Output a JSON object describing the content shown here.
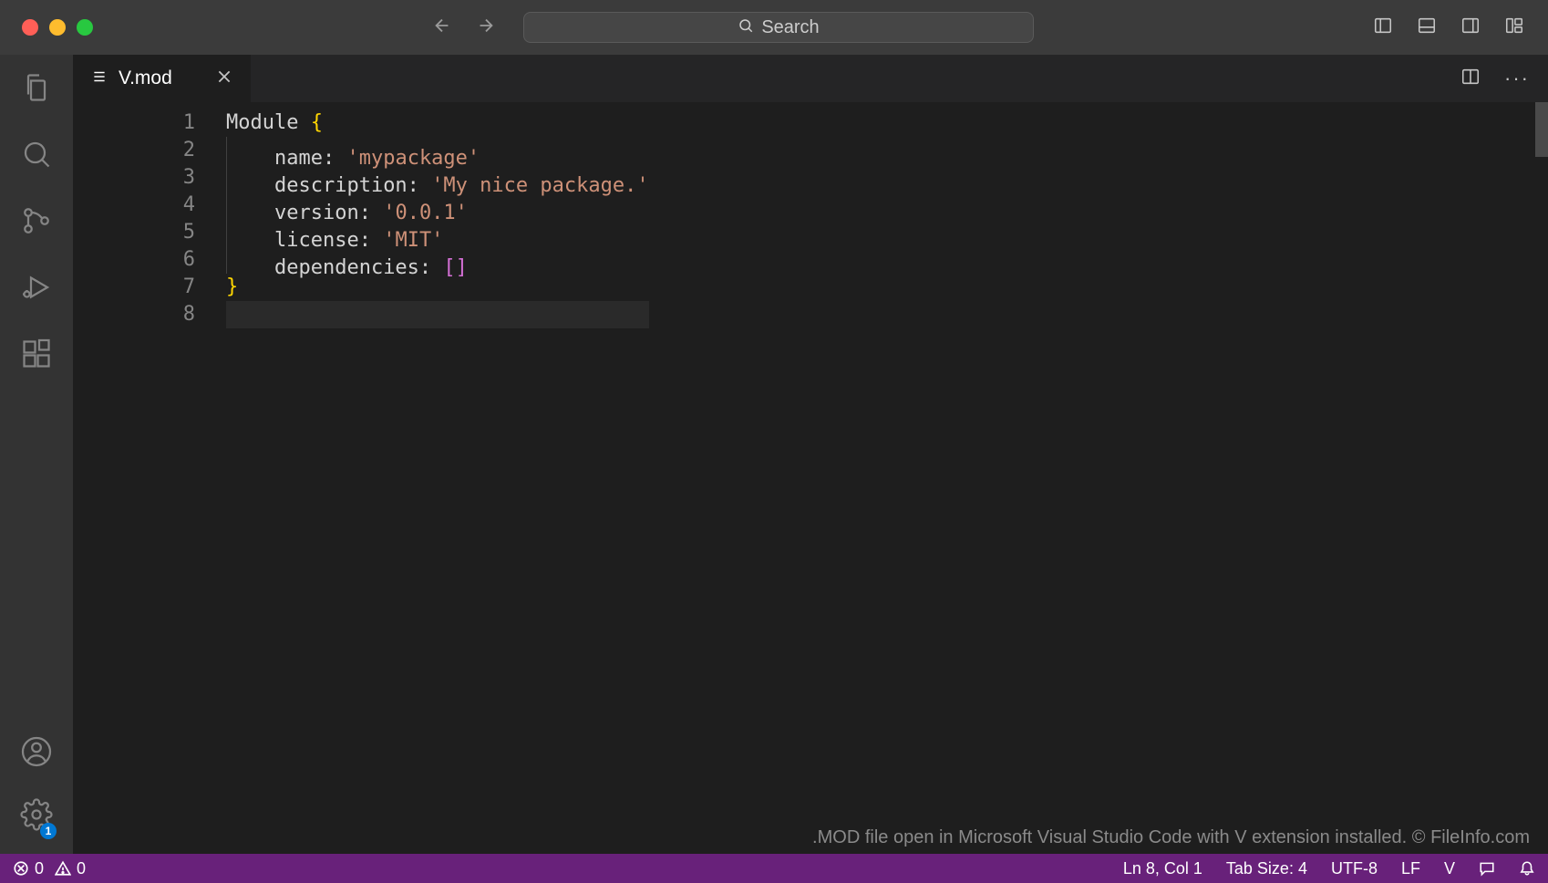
{
  "titlebar": {
    "search_placeholder": "Search"
  },
  "tab": {
    "filename": "V.mod"
  },
  "activity": {
    "settings_badge": "1"
  },
  "code": {
    "lines_count": 8,
    "content": {
      "module_keyword": "Module",
      "open_brace": "{",
      "close_brace": "}",
      "name_key": "name:",
      "name_val": "'mypackage'",
      "desc_key": "description:",
      "desc_val": "'My nice package.'",
      "ver_key": "version:",
      "ver_val": "'0.0.1'",
      "lic_key": "license:",
      "lic_val": "'MIT'",
      "dep_key": "dependencies:",
      "dep_val": "[]"
    },
    "line_numbers": [
      "1",
      "2",
      "3",
      "4",
      "5",
      "6",
      "7",
      "8"
    ]
  },
  "caption": ".MOD file open in Microsoft Visual Studio Code with V extension installed. © FileInfo.com",
  "status": {
    "errors": "0",
    "warnings": "0",
    "cursor": "Ln 8, Col 1",
    "tab_size": "Tab Size: 4",
    "encoding": "UTF-8",
    "eol": "LF",
    "language": "V"
  }
}
